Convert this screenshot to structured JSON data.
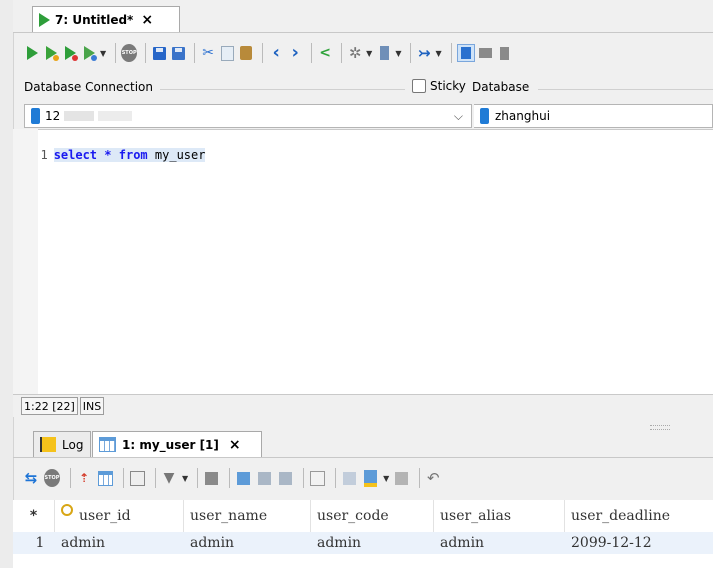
{
  "editor_tab": {
    "label": "7: Untitled*",
    "close": "×"
  },
  "connection": {
    "label": "Database Connection",
    "value": "12",
    "sticky_label": "Sticky",
    "database_label": "Database",
    "database_value": "zhanghui",
    "dropdown_arrow": "⌵"
  },
  "editor": {
    "line_number": "1",
    "sql_keyword_select": "select",
    "sql_star": "*",
    "sql_keyword_from": "from",
    "sql_table": "my_user"
  },
  "status": {
    "position": "1:22 [22]",
    "mode": "INS"
  },
  "bottom_tabs": [
    {
      "label": "Log"
    },
    {
      "label": "1: my_user [1]",
      "close": "×"
    }
  ],
  "results": {
    "row_marker_header": "*",
    "columns": [
      "user_id",
      "user_name",
      "user_code",
      "user_alias",
      "user_deadline"
    ],
    "rows": [
      {
        "num": "1",
        "cells": [
          "admin",
          "admin",
          "admin",
          "admin",
          "2099-12-12"
        ]
      }
    ]
  },
  "icons": [
    "execute-icon",
    "execute-current-icon",
    "execute-script-icon",
    "explain-icon",
    "stop-icon",
    "save-icon",
    "save-as-icon",
    "cut-icon",
    "copy-icon",
    "paste-icon",
    "back-icon",
    "forward-icon",
    "share-icon",
    "settings-icon",
    "transaction-icon",
    "jump-icon",
    "layout-icon"
  ],
  "colors": {
    "accent": "#2e9e3a",
    "keyword": "#1a1af0",
    "selection": "#dde9f7",
    "row_highlight": "#ebf2fb"
  }
}
